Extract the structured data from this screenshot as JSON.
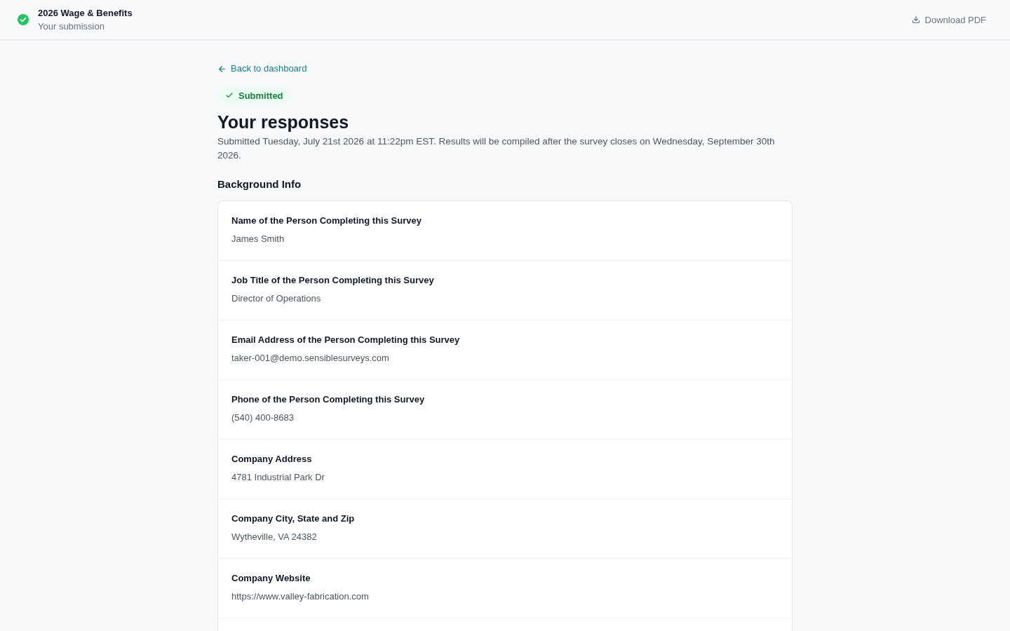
{
  "header": {
    "title": "2026 Wage & Benefits",
    "subtitle": "Your submission",
    "download_label": "Download PDF"
  },
  "back_link": "Back to dashboard",
  "status_badge": {
    "label": "Submitted",
    "kind": "success"
  },
  "heading": "Your responses",
  "description": "Submitted Tuesday, July 21st 2026 at 11:22pm EST. Results will be compiled after the survey closes on Wednesday, September 30th 2026.",
  "sections": [
    {
      "title": "Background Info",
      "questions": [
        {
          "label": "Name of the Person Completing this Survey",
          "answer": "James Smith"
        },
        {
          "label": "Job Title of the Person Completing this Survey",
          "answer": "Director of Operations"
        },
        {
          "label": "Email Address of the Person Completing this Survey",
          "answer": "taker-001@demo.sensiblesurveys.com"
        },
        {
          "label": "Phone of the Person Completing this Survey",
          "answer": "(540) 400-8683"
        },
        {
          "label": "Company Address",
          "answer": "4781 Industrial Park Dr"
        },
        {
          "label": "Company City, State and Zip",
          "answer": "Wytheville, VA 24382"
        },
        {
          "label": "Company Website",
          "answer": "https://www.valley-fabrication.com"
        }
      ]
    }
  ]
}
